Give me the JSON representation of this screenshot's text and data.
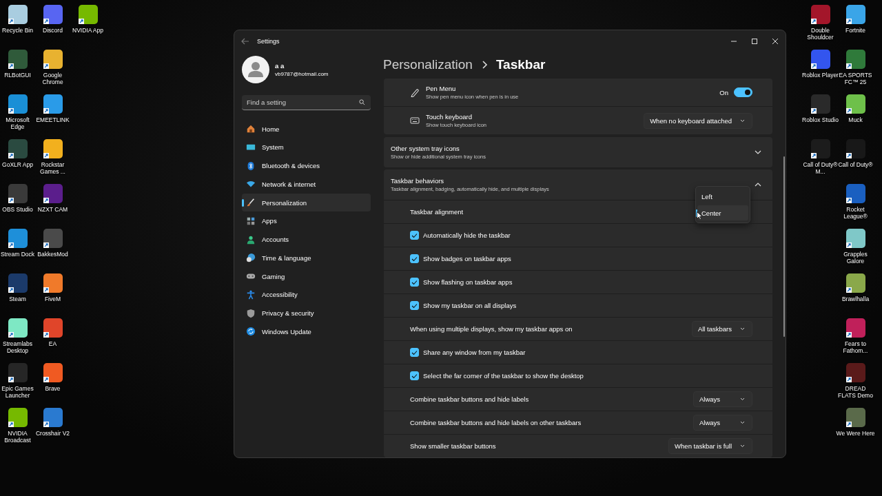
{
  "desktop": {
    "left_columns": [
      [
        {
          "label": "Recycle Bin",
          "color": "#a9cde0"
        },
        {
          "label": "RLBotGUI",
          "color": "#2f5a3a"
        },
        {
          "label": "Microsoft Edge",
          "color": "#1a8fd6"
        },
        {
          "label": "GoXLR App",
          "color": "#2a4a40"
        },
        {
          "label": "OBS Studio",
          "color": "#3a3a3a"
        },
        {
          "label": "Stream Dock",
          "color": "#1e8fd9"
        },
        {
          "label": "Steam",
          "color": "#1b3a6a"
        },
        {
          "label": "Streamlabs Desktop",
          "color": "#7ee8c4"
        },
        {
          "label": "Epic Games Launcher",
          "color": "#262626"
        },
        {
          "label": "NVIDIA Broadcast",
          "color": "#76b900"
        }
      ],
      [
        {
          "label": "Discord",
          "color": "#5865f2"
        },
        {
          "label": "Google Chrome",
          "color": "#e8b230"
        },
        {
          "label": "EMEETLINK",
          "color": "#2a9be8"
        },
        {
          "label": "Rockstar Games ...",
          "color": "#f2b01e"
        },
        {
          "label": "NZXT CAM",
          "color": "#5b1e8c"
        },
        {
          "label": "BakkesMod",
          "color": "#4a4a4a"
        },
        {
          "label": "FiveM",
          "color": "#f07a2a"
        },
        {
          "label": "EA",
          "color": "#e0452a"
        },
        {
          "label": "Brave",
          "color": "#f05a22"
        },
        {
          "label": "Crosshair V2",
          "color": "#2a7ad0"
        }
      ],
      [
        {
          "label": "NVIDIA App",
          "color": "#76b900"
        }
      ]
    ],
    "right_columns": [
      [
        {
          "label": "Double Shouldcer",
          "color": "#a3162a"
        },
        {
          "label": "Roblox Player",
          "color": "#3355ee"
        },
        {
          "label": "Roblox Studio",
          "color": "#2a2a2a"
        },
        {
          "label": "Call of Duty® M...",
          "color": "#1c1c1c"
        }
      ],
      [
        {
          "label": "Fortnite",
          "color": "#3aa5e8"
        },
        {
          "label": "EA SPORTS FC™ 25",
          "color": "#2f7a3a"
        },
        {
          "label": "Muck",
          "color": "#6ec04a"
        },
        {
          "label": "Call of Duty®",
          "color": "#181818"
        },
        {
          "label": "Rocket League®",
          "color": "#1a5fc0"
        },
        {
          "label": "Grapples Galore",
          "color": "#7fc8c8"
        },
        {
          "label": "Brawlhalla",
          "color": "#8aa84a"
        },
        {
          "label": "Fears to Fathom...",
          "color": "#c0205a"
        },
        {
          "label": "DREAD FLATS Demo",
          "color": "#5a1a1a"
        },
        {
          "label": "We Were Here",
          "color": "#5a6a4a"
        }
      ]
    ]
  },
  "window": {
    "title": "Settings"
  },
  "account": {
    "name": "a a",
    "email": "vb9787@hotmail.com"
  },
  "search": {
    "placeholder": "Find a setting"
  },
  "nav": [
    {
      "label": "Home",
      "selected": false
    },
    {
      "label": "System",
      "selected": false
    },
    {
      "label": "Bluetooth & devices",
      "selected": false
    },
    {
      "label": "Network & internet",
      "selected": false
    },
    {
      "label": "Personalization",
      "selected": true
    },
    {
      "label": "Apps",
      "selected": false
    },
    {
      "label": "Accounts",
      "selected": false
    },
    {
      "label": "Time & language",
      "selected": false
    },
    {
      "label": "Gaming",
      "selected": false
    },
    {
      "label": "Accessibility",
      "selected": false
    },
    {
      "label": "Privacy & security",
      "selected": false
    },
    {
      "label": "Windows Update",
      "selected": false
    }
  ],
  "breadcrumb": [
    "Personalization",
    "Taskbar"
  ],
  "cards": [
    {
      "rows": [
        {
          "kind": "toggle",
          "title": "Pen Menu",
          "subtitle": "Show pen menu icon when pen is in use",
          "state_label": "On",
          "on": true
        },
        {
          "kind": "dropdown",
          "title": "Touch keyboard",
          "subtitle": "Show touch keyboard icon",
          "value": "When no keyboard attached"
        }
      ]
    },
    {
      "rows": [
        {
          "kind": "expander",
          "title": "Other system tray icons",
          "subtitle": "Show or hide additional system tray icons",
          "expanded": false
        }
      ]
    },
    {
      "rows": [
        {
          "kind": "expander",
          "title": "Taskbar behaviors",
          "subtitle": "Taskbar alignment, badging, automatically hide, and multiple displays",
          "expanded": true
        },
        {
          "kind": "open_dropdown",
          "label": "Taskbar alignment",
          "options": [
            {
              "label": "Left",
              "selected": false
            },
            {
              "label": "Center",
              "selected": true
            }
          ]
        },
        {
          "kind": "checkbox",
          "label": "Automatically hide the taskbar",
          "checked": true
        },
        {
          "kind": "checkbox",
          "label": "Show badges on taskbar apps",
          "checked": true
        },
        {
          "kind": "checkbox",
          "label": "Show flashing on taskbar apps",
          "checked": true
        },
        {
          "kind": "checkbox",
          "label": "Show my taskbar on all displays",
          "checked": true
        },
        {
          "kind": "select",
          "label": "When using multiple displays, show my taskbar apps on",
          "value": "All taskbars"
        },
        {
          "kind": "checkbox",
          "label": "Share any window from my taskbar",
          "checked": true
        },
        {
          "kind": "checkbox",
          "label": "Select the far corner of the taskbar to show the desktop",
          "checked": true
        },
        {
          "kind": "select",
          "label": "Combine taskbar buttons and hide labels",
          "value": "Always"
        },
        {
          "kind": "select",
          "label": "Combine taskbar buttons and hide labels on other taskbars",
          "value": "Always"
        },
        {
          "kind": "select",
          "label": "Show smaller taskbar buttons",
          "value": "When taskbar is full"
        }
      ]
    }
  ]
}
